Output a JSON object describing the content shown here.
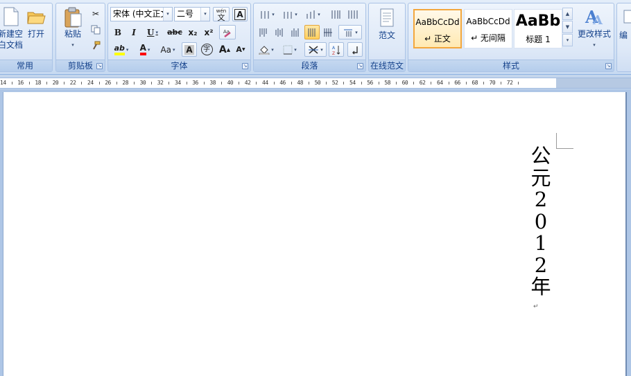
{
  "groups": {
    "common": {
      "label": "常用",
      "new_doc_line1": "新建空",
      "new_doc_line2": "白文档",
      "open": "打开"
    },
    "clipboard": {
      "label": "剪贴板",
      "paste": "粘贴"
    },
    "font": {
      "label": "字体",
      "font_name": "宋体 (中文正文)",
      "font_size": "二号",
      "bold": "B",
      "italic": "I",
      "underline": "U",
      "strike": "abc",
      "subscript": "x₂",
      "superscript": "x²",
      "change_case": "Aa",
      "char_shade": "A",
      "enclose": "字",
      "grow": "A",
      "shrink": "A",
      "phonetic": "wén",
      "phonetic_char": "文",
      "border_char": "A",
      "highlight": "ab",
      "font_color": "A"
    },
    "paragraph": {
      "label": "段落"
    },
    "templates": {
      "label": "在线范文",
      "button": "范文"
    },
    "styles": {
      "label": "样式",
      "items": [
        {
          "sample": "AaBbCcDd",
          "name": "↵ 正文"
        },
        {
          "sample": "AaBbCcDd",
          "name": "↵ 无间隔"
        },
        {
          "sample": "AaBb",
          "name": "标题 1"
        }
      ],
      "change_styles": "更改样式",
      "edit": "编"
    }
  },
  "ruler": {
    "labels": [
      "14",
      "16",
      "18",
      "20",
      "22",
      "24",
      "26",
      "28",
      "30",
      "32",
      "34",
      "36",
      "38",
      "40",
      "42",
      "44",
      "46",
      "48",
      "50",
      "52",
      "54",
      "56",
      "58",
      "60",
      "62",
      "64",
      "66",
      "68",
      "70",
      "72"
    ]
  },
  "document": {
    "vertical_chars": [
      "公",
      "元",
      "2",
      "0",
      "1",
      "2",
      "年"
    ],
    "paragraph_mark": "↵"
  },
  "colors": {
    "highlight": "#ffff00",
    "font_color": "#ff0000",
    "active_border": "#e3a53a"
  }
}
